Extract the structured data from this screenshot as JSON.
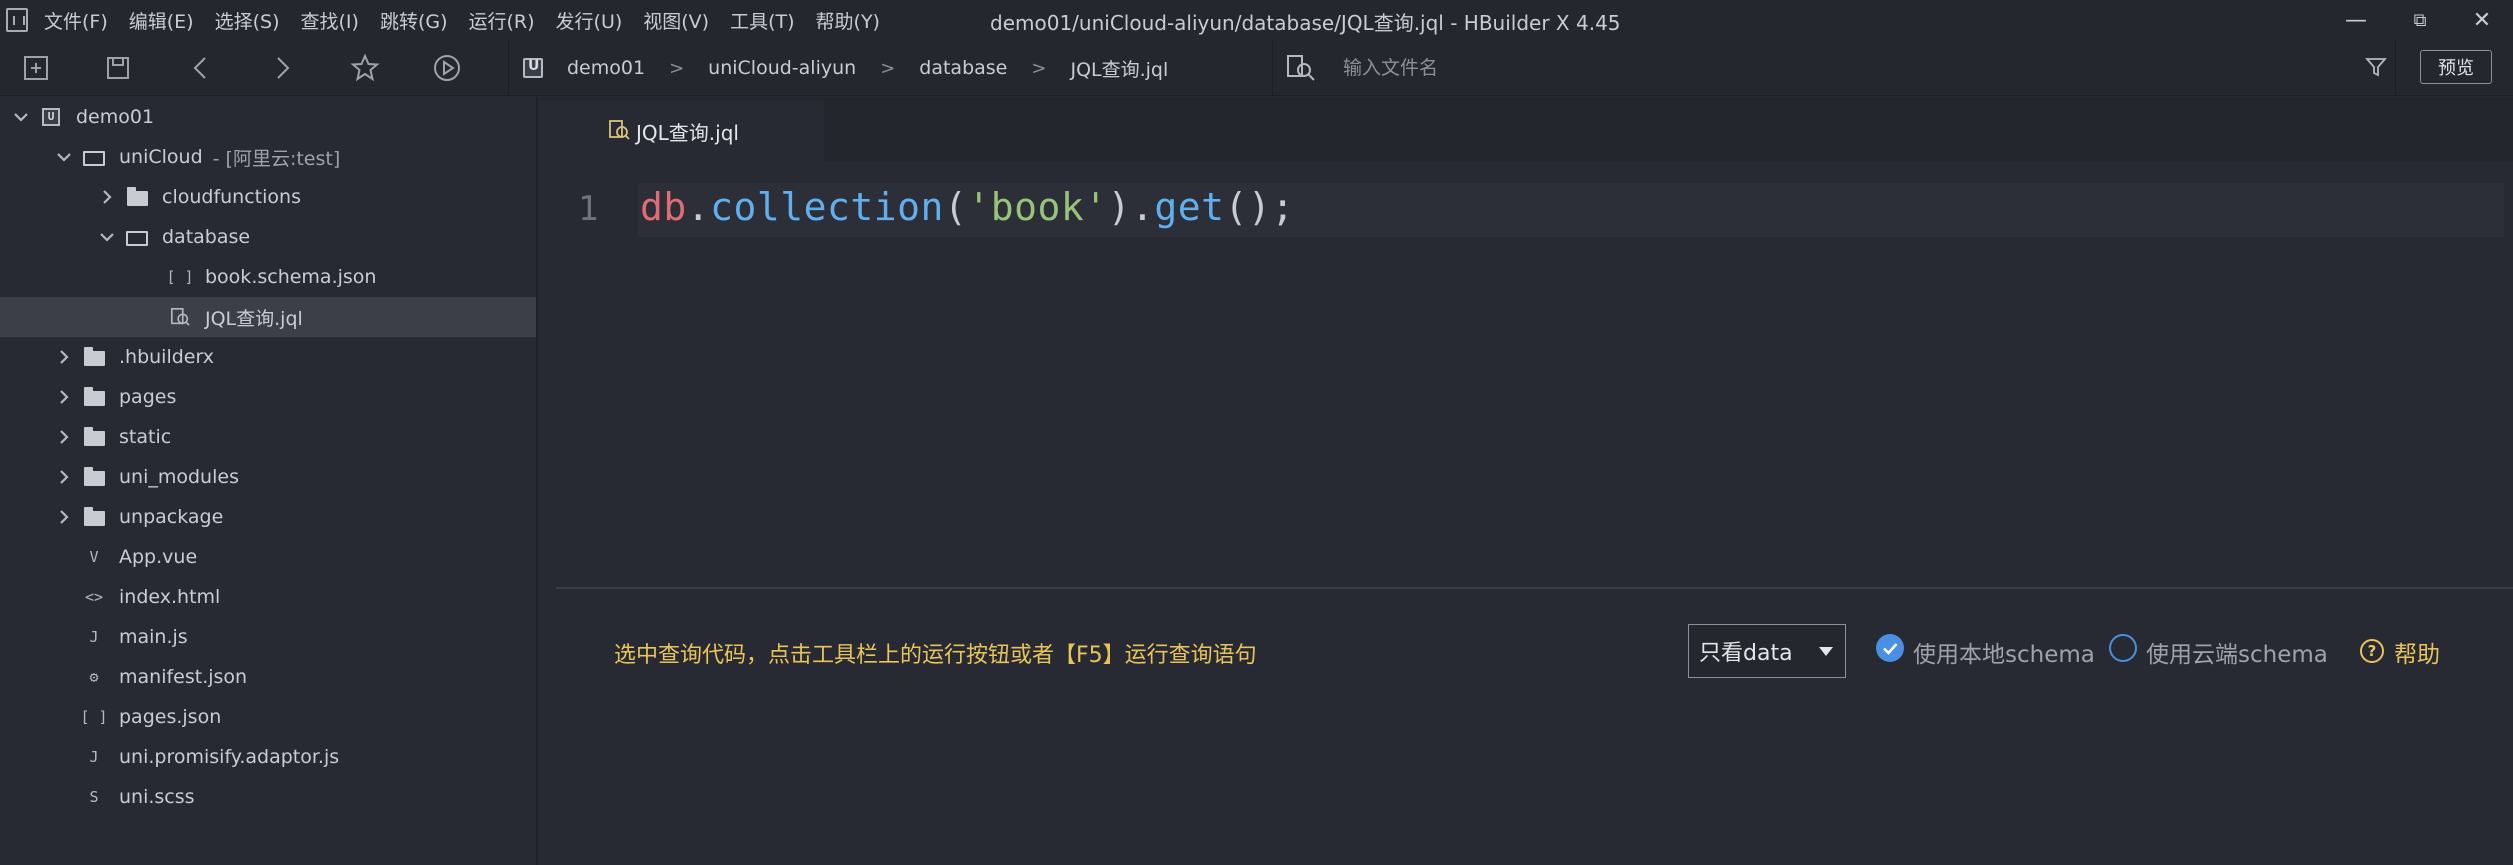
{
  "menu": [
    "文件(F)",
    "编辑(E)",
    "选择(S)",
    "查找(I)",
    "跳转(G)",
    "运行(R)",
    "发行(U)",
    "视图(V)",
    "工具(T)",
    "帮助(Y)"
  ],
  "window": {
    "title": "demo01/uniCloud-aliyun/database/JQL查询.jql - HBuilder X 4.45",
    "minimize": "—",
    "restore": "⧉",
    "close": "✕"
  },
  "toolbar": {
    "breadcrumb": [
      "demo01",
      "uniCloud-aliyun",
      "database",
      "JQL查询.jql"
    ],
    "search_placeholder": "输入文件名",
    "preview_label": "预览"
  },
  "tree": [
    {
      "label": "demo01",
      "icon": "project-icon",
      "chevron": "down"
    },
    {
      "label": "uniCloud",
      "note": "- [阿里云:test]",
      "icon": "folder-open-icon",
      "chevron": "down"
    },
    {
      "label": "cloudfunctions",
      "icon": "folder-icon",
      "chevron": "right"
    },
    {
      "label": "database",
      "icon": "folder-open-icon",
      "chevron": "down"
    },
    {
      "label": "book.schema.json",
      "icon": "json-icon",
      "glyph": "[ ]"
    },
    {
      "label": "JQL查询.jql",
      "icon": "jql-icon",
      "selected": true
    },
    {
      "label": ".hbuilderx",
      "icon": "folder-icon",
      "chevron": "right"
    },
    {
      "label": "pages",
      "icon": "folder-icon",
      "chevron": "right"
    },
    {
      "label": "static",
      "icon": "folder-icon",
      "chevron": "right"
    },
    {
      "label": "uni_modules",
      "icon": "folder-icon",
      "chevron": "right"
    },
    {
      "label": "unpackage",
      "icon": "folder-icon",
      "chevron": "right"
    },
    {
      "label": "App.vue",
      "icon": "vue-file-icon",
      "glyph": "V"
    },
    {
      "label": "index.html",
      "icon": "html-file-icon",
      "glyph": "<>"
    },
    {
      "label": "main.js",
      "icon": "js-file-icon",
      "glyph": "J"
    },
    {
      "label": "manifest.json",
      "icon": "manifest-icon",
      "glyph": "⚙"
    },
    {
      "label": "pages.json",
      "icon": "json-icon",
      "glyph": "[ ]"
    },
    {
      "label": "uni.promisify.adaptor.js",
      "icon": "js-file-icon",
      "glyph": "J"
    },
    {
      "label": "uni.scss",
      "icon": "scss-file-icon",
      "glyph": "S"
    }
  ],
  "editor": {
    "tab": "JQL查询.jql",
    "line_number": "1",
    "code": {
      "obj": "db",
      "dot1": ".",
      "fn1": "collection",
      "open1": "(",
      "str": "'book'",
      "close1": ")",
      "dot2": ".",
      "fn2": "get",
      "tail": "();"
    }
  },
  "query_panel": {
    "hint": "选中查询代码，点击工具栏上的运行按钮或者【F5】运行查询语句",
    "select_value": "只看data",
    "local_schema": "使用本地schema",
    "cloud_schema": "使用云端schema",
    "help": "帮助"
  },
  "colors": {
    "accent": "#4a90e2",
    "hint": "#e8c45a"
  }
}
